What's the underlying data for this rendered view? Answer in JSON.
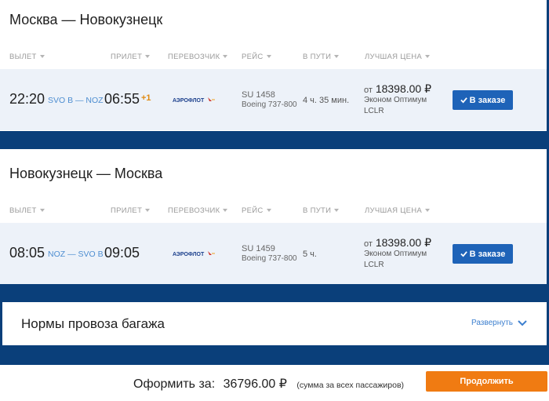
{
  "columns": [
    "ВЫЛЕТ",
    "ПРИЛЕТ",
    "ПЕРЕВОЗЧИК",
    "РЕЙС",
    "В ПУТИ",
    "ЛУЧШАЯ ЦЕНА"
  ],
  "segments": [
    {
      "route_title": "Москва — Новокузнецк",
      "depart_time": "22:20",
      "route_codes": "SVO B — NOZ",
      "arrive_time": "06:55",
      "day_offset": "+1",
      "carrier": "АЭРОФЛОТ",
      "flight_no": "SU 1458",
      "aircraft": "Boeing 737-800",
      "duration": "4 ч. 35 мин.",
      "price_prefix": "от",
      "price": "18398.00 ₽",
      "fare_class": "Эконом Оптимум",
      "fare_code": "LCLR",
      "order_label": "В заказе"
    },
    {
      "route_title": "Новокузнецк — Москва",
      "depart_time": "08:05",
      "route_codes": "NOZ — SVO B",
      "arrive_time": "09:05",
      "day_offset": "",
      "carrier": "АЭРОФЛОТ",
      "flight_no": "SU 1459",
      "aircraft": "Boeing 737-800",
      "duration": "5 ч.",
      "price_prefix": "от",
      "price": "18398.00 ₽",
      "fare_class": "Эконом Оптимум",
      "fare_code": "LCLR",
      "order_label": "В заказе"
    }
  ],
  "baggage": {
    "title": "Нормы провоза багажа",
    "expand_label": "Развернуть"
  },
  "footer": {
    "checkout_label": "Оформить за:",
    "total": "36796.00 ₽",
    "note": "(сумма за всех пассажиров)",
    "continue_label": "Продолжить"
  },
  "colors": {
    "brand_blue": "#1e63b8",
    "accent_orange": "#f07b12",
    "page_bg": "#0a3f7a"
  }
}
